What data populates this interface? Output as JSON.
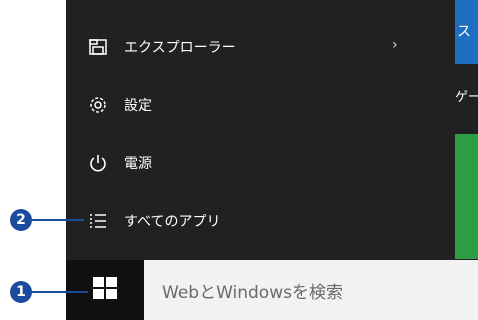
{
  "start_menu": {
    "items": [
      {
        "label": "エクスプローラー",
        "icon": "file-explorer-icon",
        "has_submenu": true
      },
      {
        "label": "設定",
        "icon": "gear-icon"
      },
      {
        "label": "電源",
        "icon": "power-icon"
      },
      {
        "label": "すべてのアプリ",
        "icon": "list-icon"
      }
    ],
    "submenu_glyph": "›"
  },
  "tiles": {
    "blue_tile_text": "ス",
    "group_label": "ゲー"
  },
  "taskbar": {
    "search_placeholder": "WebとWindowsを検索",
    "start_button": "windows-logo-icon"
  },
  "callouts": [
    {
      "number": "2"
    },
    {
      "number": "1"
    }
  ],
  "colors": {
    "start_bg": "#212121",
    "taskbar_bg": "#101010",
    "search_bg": "#f2f2f2",
    "callout": "#1b4b9c",
    "tile_blue": "#1e6fc2",
    "tile_green": "#2e9c43"
  }
}
